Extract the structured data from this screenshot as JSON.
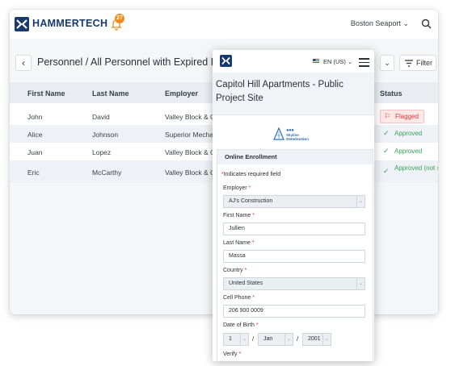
{
  "app": {
    "brand": "HAMMERTECH",
    "notification_count": "27",
    "location": "Boston Seaport",
    "location_caret": "⌄"
  },
  "page": {
    "breadcrumb": "Personnel / All Personnel with Expired Lic",
    "back_glyph": "‹",
    "dropdown_caret": "⌄",
    "filter_label": "Filter"
  },
  "table": {
    "columns": [
      "First Name",
      "Last Name",
      "Employer",
      "Status"
    ],
    "rows": [
      {
        "first": "John",
        "last": "David",
        "employer": "Valley Block & C",
        "status": "Flagged"
      },
      {
        "first": "Alice",
        "last": "Johnson",
        "employer": "Superior Mecha",
        "status": "Approved"
      },
      {
        "first": "Juan",
        "last": "Lopez",
        "employer": "Valley Block & C",
        "status": "Approved"
      },
      {
        "first": "Eric",
        "last": "McCarthy",
        "employer": "Valley Block & C",
        "status": "Approved (not signed)"
      }
    ],
    "status_icons": {
      "flag": "⚐",
      "check": "✓"
    }
  },
  "mobile": {
    "language": "EN (US)",
    "language_caret": "⌄",
    "site_title": "Capitol Hill Apartments - Public Project Site",
    "company_logo": {
      "dots": "●●●",
      "name": "Skyline Construction",
      "tagline": "Building the future"
    },
    "form": {
      "heading": "Online Enrollment",
      "required_star": "*",
      "required_note": "Indicates required field",
      "employer_label": "Employer",
      "employer_value": "AJ's Construction",
      "first_name_label": "First Name",
      "first_name_value": "Jullien",
      "last_name_label": "Last Name",
      "last_name_value": "Massa",
      "country_label": "Country",
      "country_value": "United States",
      "cell_phone_label": "Cell Phone",
      "cell_phone_value": "206 900 0009",
      "dob_label": "Date of Birth",
      "dob_day": "1",
      "dob_month": "Jan",
      "dob_year": "2001",
      "dob_separator": "/",
      "select_caret": "⌄",
      "verify_label": "Verify"
    }
  },
  "colors": {
    "brand_navy": "#163a6b",
    "flag_red": "#d9363e",
    "approved_green": "#37a55a",
    "badge_orange": "#f08a1c"
  }
}
